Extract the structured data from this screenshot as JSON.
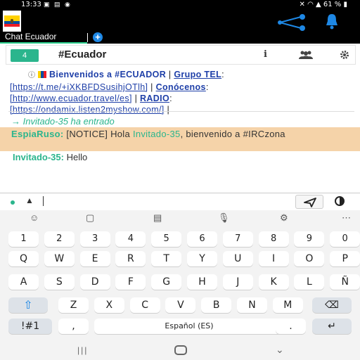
{
  "status": {
    "time": "13:33",
    "battery": "61 %"
  },
  "tabbar": {
    "tab_label": "Chat Ecuador",
    "add_label": "+"
  },
  "channel": {
    "badge": "4",
    "name": "#Ecuador",
    "info_label": "i"
  },
  "topic": {
    "welcome": "Bienvenidos a #ECUADOR",
    "pipe1": " | ",
    "grupo_label": "Grupo TEL",
    "colon": ":",
    "link_tel": "[https://t.me/+iXKBFDSusihjOTlh]",
    "pipe2": " | ",
    "conocenos_label": "Conócenos",
    "link_travel": "[http://www.ecuador.travel/es]",
    "pipe3": " | ",
    "radio_label": "RADIO",
    "link_radio": "[https://ondamix.listen2myshow.com/]",
    "pipe4": " |"
  },
  "messages": {
    "join": "→ Invitado-35 ha entrado",
    "notice_nick": "EspiaRuso:",
    "notice_text_1": " [NOTICE] Hola ",
    "notice_highlight": "Invitado-35",
    "notice_text_2": ", bienvenido a #IRCzona",
    "msg_nick": "Invitado-35:",
    "msg_text": " Hello"
  },
  "input": {
    "history_label": "▲"
  },
  "keyboard": {
    "row_numbers": [
      "1",
      "2",
      "3",
      "4",
      "5",
      "6",
      "7",
      "8",
      "9",
      "0"
    ],
    "row1": [
      "Q",
      "W",
      "E",
      "R",
      "T",
      "Y",
      "U",
      "I",
      "O",
      "P"
    ],
    "row2": [
      "A",
      "S",
      "D",
      "F",
      "G",
      "H",
      "J",
      "K",
      "L",
      "Ñ"
    ],
    "row3": [
      "Z",
      "X",
      "C",
      "V",
      "B",
      "N",
      "M"
    ],
    "symbols_label": "!#1",
    "comma": ",",
    "space_label": "Español (ES)",
    "period": ".",
    "top_icons": [
      "emoji-icon",
      "sticker-icon",
      "clipboard-icon",
      "mic-icon",
      "settings-icon",
      "more-icon"
    ]
  },
  "colors": {
    "accent": "#2bb58d",
    "link": "#1e3fa8",
    "notice_bg": "#f5d3a9",
    "tab_indicator": "#2ecf8e"
  }
}
